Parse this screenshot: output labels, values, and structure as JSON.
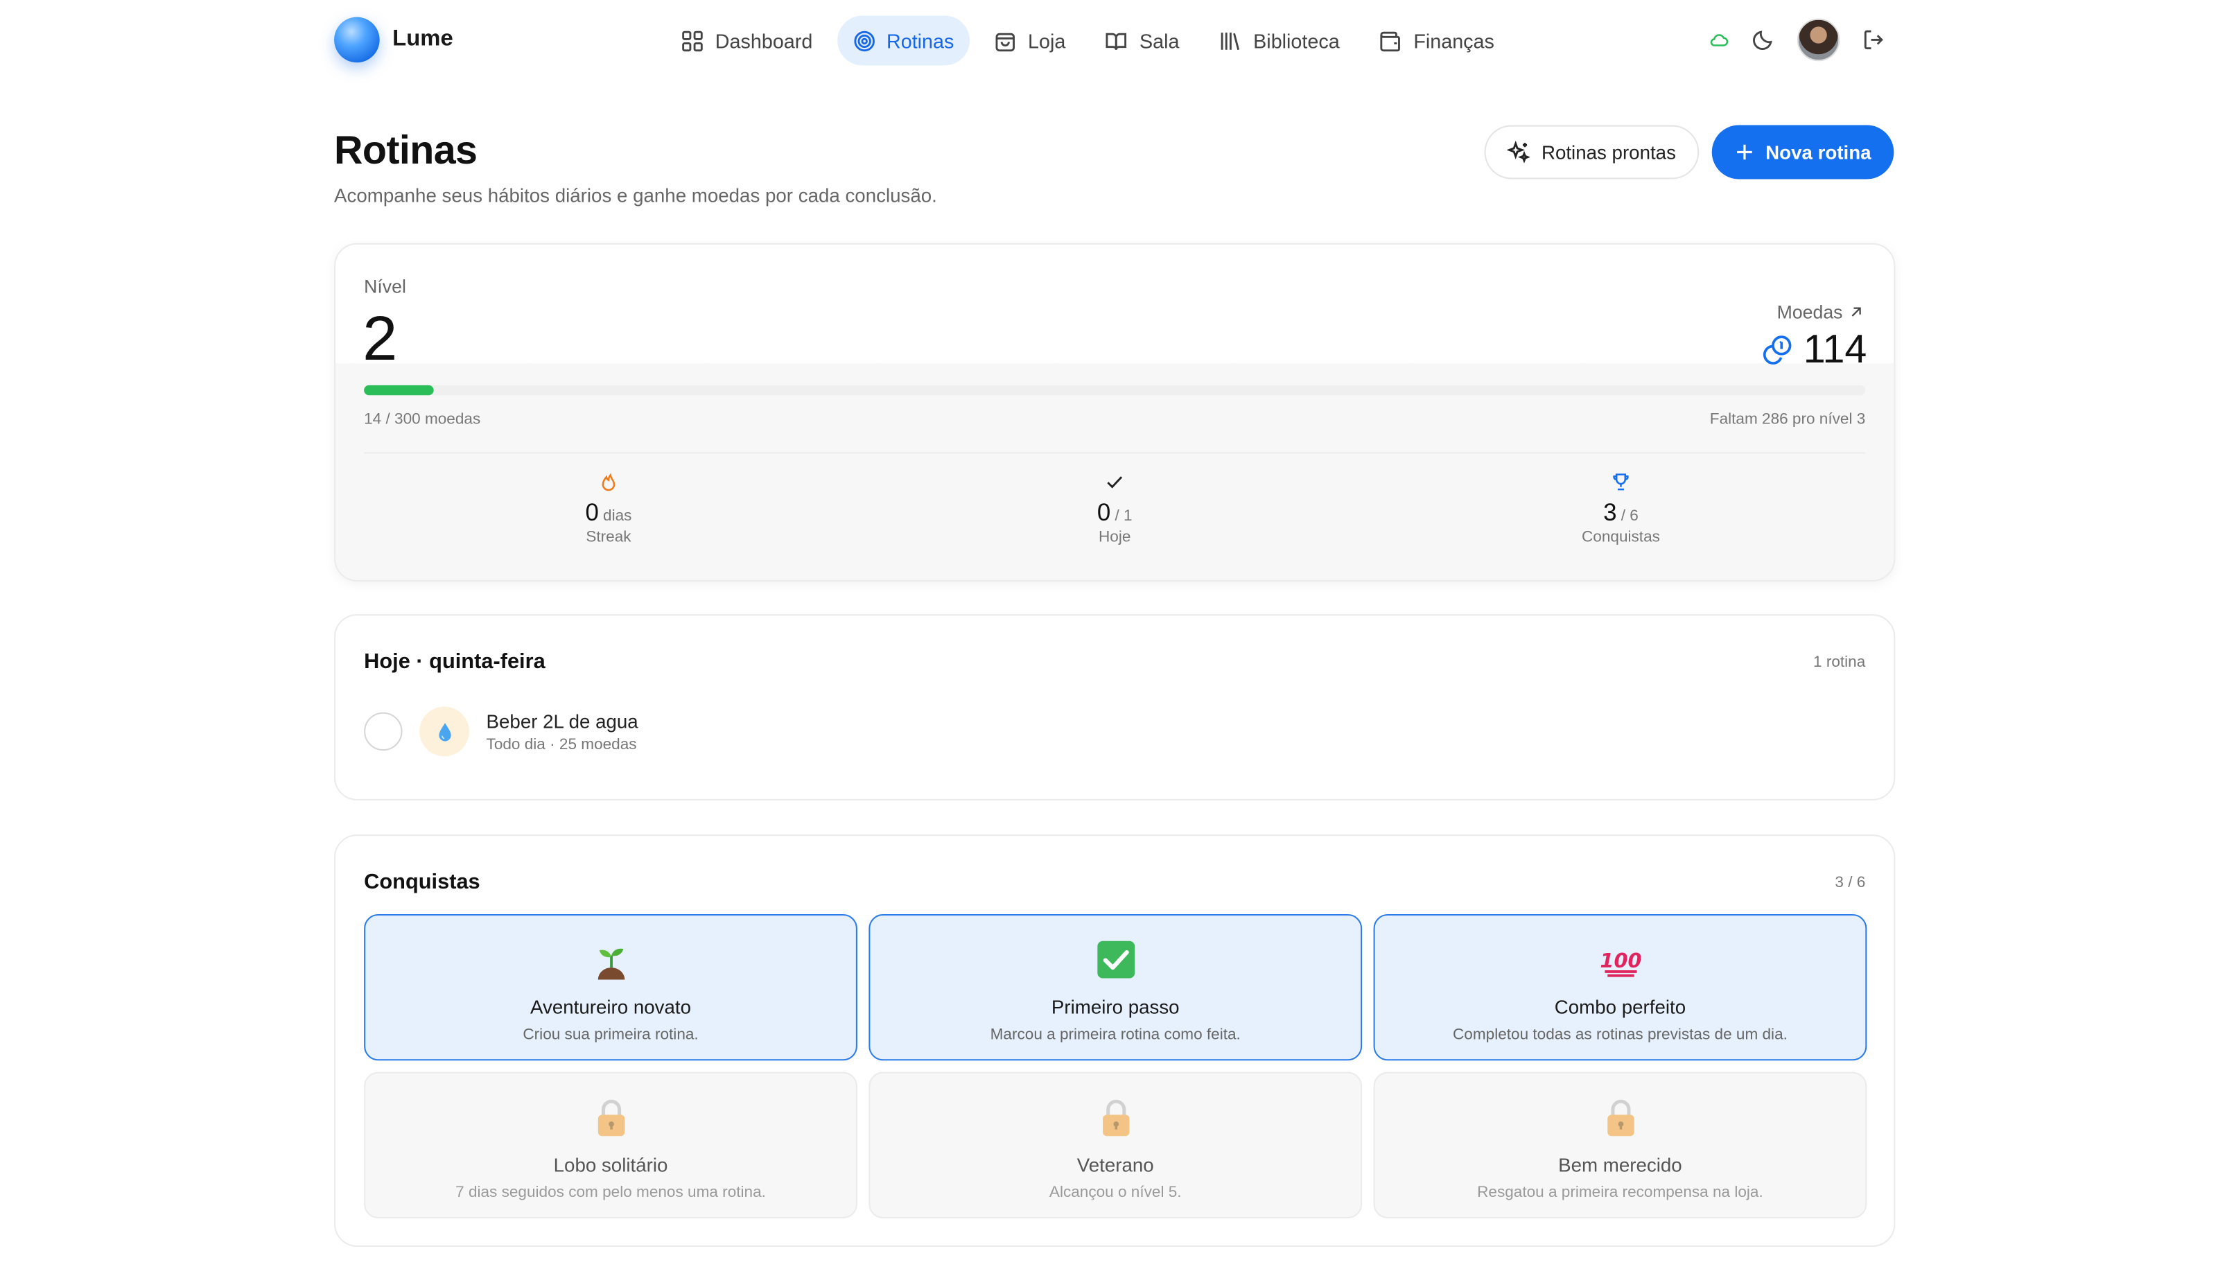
{
  "brand": {
    "name": "Lume"
  },
  "nav": [
    {
      "label": "Dashboard",
      "icon": "grid-icon",
      "active": false
    },
    {
      "label": "Rotinas",
      "icon": "target-icon",
      "active": true
    },
    {
      "label": "Loja",
      "icon": "shopping-bag-icon",
      "active": false
    },
    {
      "label": "Sala",
      "icon": "book-open-icon",
      "active": false
    },
    {
      "label": "Biblioteca",
      "icon": "library-icon",
      "active": false
    },
    {
      "label": "Finanças",
      "icon": "wallet-icon",
      "active": false
    }
  ],
  "top_actions": {
    "status_icon": "cloud-icon",
    "theme_icon": "moon-icon",
    "logout_icon": "logout-icon"
  },
  "page": {
    "title": "Rotinas",
    "subtitle": "Acompanhe seus hábitos diários e ganhe moedas por cada conclusão.",
    "secondary_button": "Rotinas prontas",
    "primary_button": "Nova rotina"
  },
  "level": {
    "label": "Nível",
    "value": "2",
    "coins_label": "Moedas",
    "coins_value": "114",
    "progress_text": "14 / 300 moedas",
    "progress_fraction": 0.0467,
    "remaining_text": "Faltam 286 pro nível 3"
  },
  "stats": [
    {
      "value": "0",
      "unit": "dias",
      "label": "Streak",
      "icon": "flame-icon"
    },
    {
      "value": "0",
      "unit": "/ 1",
      "label": "Hoje",
      "icon": "check-icon"
    },
    {
      "value": "3",
      "unit": "/ 6",
      "label": "Conquistas",
      "icon": "trophy-icon"
    }
  ],
  "today": {
    "title": "Hoje · quinta-feira",
    "count": "1 rotina",
    "routines": [
      {
        "name": "Beber 2L de agua",
        "sub": "Todo dia · 25 moedas",
        "icon": "water-drop-icon",
        "done": false
      }
    ]
  },
  "achievements": {
    "title": "Conquistas",
    "count": "3 / 6",
    "items": [
      {
        "title": "Aventureiro novato",
        "desc": "Criou sua primeira rotina.",
        "icon": "seedling-icon",
        "unlocked": true
      },
      {
        "title": "Primeiro passo",
        "desc": "Marcou a primeira rotina como feita.",
        "icon": "check-box-icon",
        "unlocked": true
      },
      {
        "title": "Combo perfeito",
        "desc": "Completou todas as rotinas previstas de um dia.",
        "icon": "hundred-points-icon",
        "unlocked": true
      },
      {
        "title": "Lobo solitário",
        "desc": "7 dias seguidos com pelo menos uma rotina.",
        "icon": "lock-icon",
        "unlocked": false
      },
      {
        "title": "Veterano",
        "desc": "Alcançou o nível 5.",
        "icon": "lock-icon",
        "unlocked": false
      },
      {
        "title": "Bem merecido",
        "desc": "Resgatou a primeira recompensa na loja.",
        "icon": "lock-icon",
        "unlocked": false
      }
    ]
  },
  "colors": {
    "accent": "#1570ef",
    "active_nav_bg": "#e3effd",
    "progress": "#2bbd58",
    "flame": "#f07a1a"
  }
}
